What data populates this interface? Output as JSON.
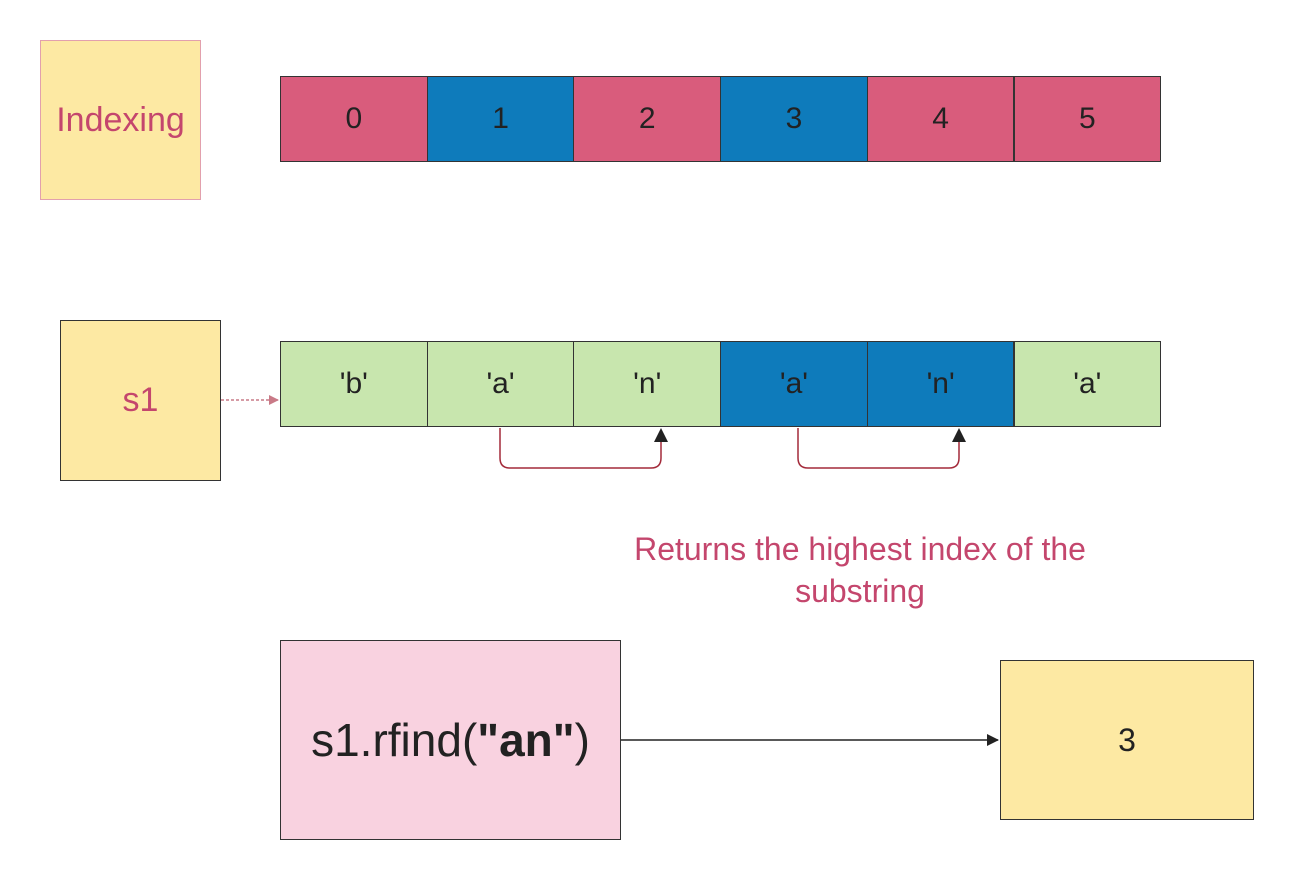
{
  "colors": {
    "pink": "#d95c7c",
    "blue": "#0e7bbb",
    "green": "#c8e6ae",
    "yellow": "#fde9a3",
    "light_pink": "#f9d2e0",
    "accent_text": "#c4466d",
    "arrow_red": "#a32a3a"
  },
  "indexing": {
    "label": "Indexing",
    "cells": [
      "0",
      "1",
      "2",
      "3",
      "4",
      "5"
    ],
    "cell_colors": [
      "pink",
      "blue",
      "pink",
      "blue",
      "pink",
      "pink"
    ]
  },
  "string_row": {
    "variable": "s1",
    "cells": [
      "'b'",
      "'a'",
      "'n'",
      "'a'",
      "'n'",
      "'a'"
    ],
    "cell_colors": [
      "green",
      "green",
      "green",
      "blue",
      "blue",
      "green"
    ]
  },
  "note": {
    "line1": "Returns the highest index of the",
    "line2": "substring"
  },
  "call": {
    "prefix": "s1.rfind(",
    "argument": "\"an\"",
    "suffix": ")"
  },
  "result": {
    "value": "3"
  }
}
